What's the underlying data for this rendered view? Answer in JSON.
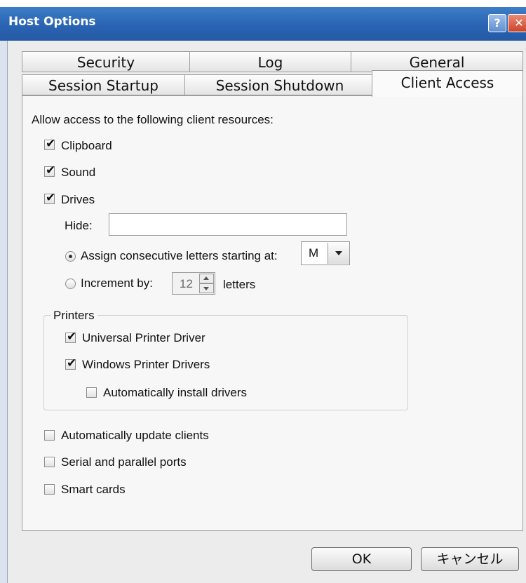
{
  "window": {
    "title": "Host Options",
    "help_glyph": "?",
    "close_glyph": "✕"
  },
  "tabs": {
    "row1": [
      {
        "label": "Security"
      },
      {
        "label": "Log"
      },
      {
        "label": "General"
      }
    ],
    "row2": [
      {
        "label": "Session Startup"
      },
      {
        "label": "Session Shutdown"
      },
      {
        "label": "Client Access",
        "selected": true
      }
    ]
  },
  "panel": {
    "intro": "Allow access to the following client resources:",
    "clipboard": {
      "label": "Clipboard",
      "checked": true
    },
    "sound": {
      "label": "Sound",
      "checked": true
    },
    "drives": {
      "label": "Drives",
      "checked": true
    },
    "hide": {
      "label": "Hide:",
      "value": ""
    },
    "assign": {
      "label": "Assign consecutive letters starting at:",
      "selected": true,
      "letter": "M"
    },
    "increment": {
      "label": "Increment by:",
      "selected": false,
      "value": "12",
      "suffix": "letters"
    },
    "printers": {
      "title": "Printers",
      "universal": {
        "label": "Universal Printer Driver",
        "checked": true
      },
      "windows": {
        "label": "Windows Printer Drivers",
        "checked": true
      },
      "auto_install": {
        "label": "Automatically install drivers",
        "checked": false
      }
    },
    "auto_update": {
      "label": "Automatically update clients",
      "checked": false
    },
    "serial": {
      "label": "Serial and parallel ports",
      "checked": false
    },
    "smart": {
      "label": "Smart cards",
      "checked": false
    }
  },
  "buttons": {
    "ok": "OK",
    "cancel": "キャンセル"
  }
}
